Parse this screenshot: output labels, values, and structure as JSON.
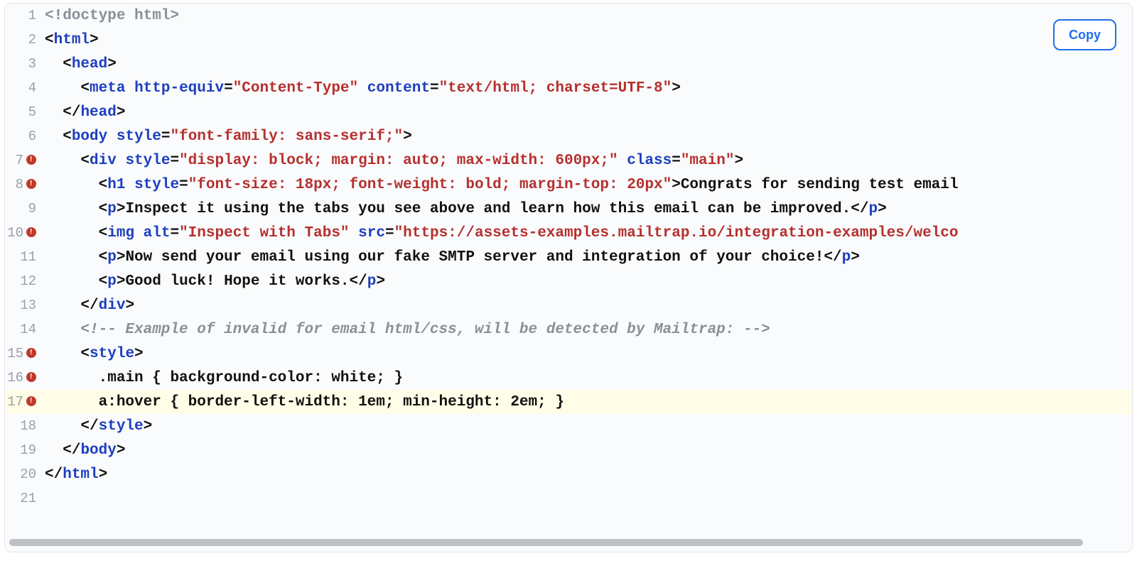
{
  "copy_label": "Copy",
  "lines": [
    {
      "num": 1,
      "marker": false,
      "hl": false,
      "indent": 0,
      "tokens": [
        {
          "c": "t-doctype",
          "t": "<!doctype html>"
        }
      ]
    },
    {
      "num": 2,
      "marker": false,
      "hl": false,
      "indent": 0,
      "tokens": [
        {
          "c": "t-punct",
          "t": "<"
        },
        {
          "c": "t-tag",
          "t": "html"
        },
        {
          "c": "t-punct",
          "t": ">"
        }
      ]
    },
    {
      "num": 3,
      "marker": false,
      "hl": false,
      "indent": 1,
      "tokens": [
        {
          "c": "t-punct",
          "t": "<"
        },
        {
          "c": "t-tag",
          "t": "head"
        },
        {
          "c": "t-punct",
          "t": ">"
        }
      ]
    },
    {
      "num": 4,
      "marker": false,
      "hl": false,
      "indent": 2,
      "tokens": [
        {
          "c": "t-punct",
          "t": "<"
        },
        {
          "c": "t-tag",
          "t": "meta"
        },
        {
          "c": "t-text",
          "t": " "
        },
        {
          "c": "t-attr",
          "t": "http-equiv"
        },
        {
          "c": "t-puncteq",
          "t": "="
        },
        {
          "c": "t-string",
          "t": "\"Content-Type\""
        },
        {
          "c": "t-text",
          "t": " "
        },
        {
          "c": "t-attr",
          "t": "content"
        },
        {
          "c": "t-puncteq",
          "t": "="
        },
        {
          "c": "t-string",
          "t": "\"text/html; charset=UTF-8\""
        },
        {
          "c": "t-punct",
          "t": ">"
        }
      ]
    },
    {
      "num": 5,
      "marker": false,
      "hl": false,
      "indent": 1,
      "tokens": [
        {
          "c": "t-punct",
          "t": "</"
        },
        {
          "c": "t-tag",
          "t": "head"
        },
        {
          "c": "t-punct",
          "t": ">"
        }
      ]
    },
    {
      "num": 6,
      "marker": false,
      "hl": false,
      "indent": 1,
      "tokens": [
        {
          "c": "t-punct",
          "t": "<"
        },
        {
          "c": "t-tag",
          "t": "body"
        },
        {
          "c": "t-text",
          "t": " "
        },
        {
          "c": "t-attr",
          "t": "style"
        },
        {
          "c": "t-puncteq",
          "t": "="
        },
        {
          "c": "t-string",
          "t": "\"font-family: sans-serif;\""
        },
        {
          "c": "t-punct",
          "t": ">"
        }
      ]
    },
    {
      "num": 7,
      "marker": true,
      "hl": false,
      "indent": 2,
      "tokens": [
        {
          "c": "t-punct",
          "t": "<"
        },
        {
          "c": "t-tag",
          "t": "div"
        },
        {
          "c": "t-text",
          "t": " "
        },
        {
          "c": "t-attr",
          "t": "style"
        },
        {
          "c": "t-puncteq",
          "t": "="
        },
        {
          "c": "t-string",
          "t": "\"display: block; margin: auto; max-width: 600px;\""
        },
        {
          "c": "t-text",
          "t": " "
        },
        {
          "c": "t-attr",
          "t": "class"
        },
        {
          "c": "t-puncteq",
          "t": "="
        },
        {
          "c": "t-string",
          "t": "\"main\""
        },
        {
          "c": "t-punct",
          "t": ">"
        }
      ]
    },
    {
      "num": 8,
      "marker": true,
      "hl": false,
      "indent": 3,
      "tokens": [
        {
          "c": "t-punct",
          "t": "<"
        },
        {
          "c": "t-tag",
          "t": "h1"
        },
        {
          "c": "t-text",
          "t": " "
        },
        {
          "c": "t-attr",
          "t": "style"
        },
        {
          "c": "t-puncteq",
          "t": "="
        },
        {
          "c": "t-string",
          "t": "\"font-size: 18px; font-weight: bold; margin-top: 20px\""
        },
        {
          "c": "t-punct",
          "t": ">"
        },
        {
          "c": "t-text",
          "t": "Congrats for sending test email "
        }
      ]
    },
    {
      "num": 9,
      "marker": false,
      "hl": false,
      "indent": 3,
      "tokens": [
        {
          "c": "t-punct",
          "t": "<"
        },
        {
          "c": "t-tag",
          "t": "p"
        },
        {
          "c": "t-punct",
          "t": ">"
        },
        {
          "c": "t-text",
          "t": "Inspect it using the tabs you see above and learn how this email can be improved."
        },
        {
          "c": "t-punct",
          "t": "</"
        },
        {
          "c": "t-tag",
          "t": "p"
        },
        {
          "c": "t-punct",
          "t": ">"
        }
      ]
    },
    {
      "num": 10,
      "marker": true,
      "hl": false,
      "indent": 3,
      "tokens": [
        {
          "c": "t-punct",
          "t": "<"
        },
        {
          "c": "t-tag",
          "t": "img"
        },
        {
          "c": "t-text",
          "t": " "
        },
        {
          "c": "t-attr",
          "t": "alt"
        },
        {
          "c": "t-puncteq",
          "t": "="
        },
        {
          "c": "t-string",
          "t": "\"Inspect with Tabs\""
        },
        {
          "c": "t-text",
          "t": " "
        },
        {
          "c": "t-attr",
          "t": "src"
        },
        {
          "c": "t-puncteq",
          "t": "="
        },
        {
          "c": "t-string",
          "t": "\"https://assets-examples.mailtrap.io/integration-examples/welco"
        }
      ]
    },
    {
      "num": 11,
      "marker": false,
      "hl": false,
      "indent": 3,
      "tokens": [
        {
          "c": "t-punct",
          "t": "<"
        },
        {
          "c": "t-tag",
          "t": "p"
        },
        {
          "c": "t-punct",
          "t": ">"
        },
        {
          "c": "t-text",
          "t": "Now send your email using our fake SMTP server and integration of your choice!"
        },
        {
          "c": "t-punct",
          "t": "</"
        },
        {
          "c": "t-tag",
          "t": "p"
        },
        {
          "c": "t-punct",
          "t": ">"
        }
      ]
    },
    {
      "num": 12,
      "marker": false,
      "hl": false,
      "indent": 3,
      "tokens": [
        {
          "c": "t-punct",
          "t": "<"
        },
        {
          "c": "t-tag",
          "t": "p"
        },
        {
          "c": "t-punct",
          "t": ">"
        },
        {
          "c": "t-text",
          "t": "Good luck! Hope it works."
        },
        {
          "c": "t-punct",
          "t": "</"
        },
        {
          "c": "t-tag",
          "t": "p"
        },
        {
          "c": "t-punct",
          "t": ">"
        }
      ]
    },
    {
      "num": 13,
      "marker": false,
      "hl": false,
      "indent": 2,
      "tokens": [
        {
          "c": "t-punct",
          "t": "</"
        },
        {
          "c": "t-tag",
          "t": "div"
        },
        {
          "c": "t-punct",
          "t": ">"
        }
      ]
    },
    {
      "num": 14,
      "marker": false,
      "hl": false,
      "indent": 2,
      "tokens": [
        {
          "c": "t-comment",
          "t": "<!-- Example of invalid for email html/css, will be detected by Mailtrap: -->"
        }
      ]
    },
    {
      "num": 15,
      "marker": true,
      "hl": false,
      "indent": 2,
      "tokens": [
        {
          "c": "t-punct",
          "t": "<"
        },
        {
          "c": "t-tag",
          "t": "style"
        },
        {
          "c": "t-punct",
          "t": ">"
        }
      ]
    },
    {
      "num": 16,
      "marker": true,
      "hl": false,
      "indent": 3,
      "tokens": [
        {
          "c": "t-css",
          "t": ".main { background-color: white; }"
        }
      ]
    },
    {
      "num": 17,
      "marker": true,
      "hl": true,
      "indent": 3,
      "tokens": [
        {
          "c": "t-css",
          "t": "a:hover { border-left-width: 1em; min-height: 2em; }"
        }
      ]
    },
    {
      "num": 18,
      "marker": false,
      "hl": false,
      "indent": 2,
      "tokens": [
        {
          "c": "t-punct",
          "t": "</"
        },
        {
          "c": "t-tag",
          "t": "style"
        },
        {
          "c": "t-punct",
          "t": ">"
        }
      ]
    },
    {
      "num": 19,
      "marker": false,
      "hl": false,
      "indent": 1,
      "tokens": [
        {
          "c": "t-punct",
          "t": "</"
        },
        {
          "c": "t-tag",
          "t": "body"
        },
        {
          "c": "t-punct",
          "t": ">"
        }
      ]
    },
    {
      "num": 20,
      "marker": false,
      "hl": false,
      "indent": 0,
      "tokens": [
        {
          "c": "t-punct",
          "t": "</"
        },
        {
          "c": "t-tag",
          "t": "html"
        },
        {
          "c": "t-punct",
          "t": ">"
        }
      ]
    },
    {
      "num": 21,
      "marker": false,
      "hl": false,
      "indent": 0,
      "tokens": []
    }
  ]
}
